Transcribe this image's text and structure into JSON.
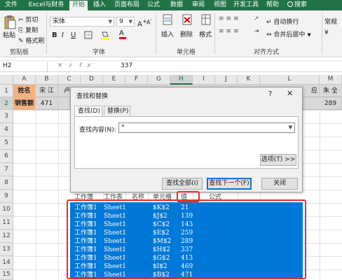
{
  "tabs": [
    {
      "label": "文件",
      "active": false
    },
    {
      "label": "Excel与财务",
      "active": false
    },
    {
      "label": "开始",
      "active": true
    },
    {
      "label": "插入",
      "active": false
    },
    {
      "label": "页面布局",
      "active": false
    },
    {
      "label": "公式",
      "active": false
    },
    {
      "label": "数据",
      "active": false
    },
    {
      "label": "审阅",
      "active": false
    },
    {
      "label": "视图",
      "active": false
    },
    {
      "label": "开发工具",
      "active": false
    },
    {
      "label": "帮助",
      "active": false
    }
  ],
  "search_label": "搜索",
  "colors": {
    "accent": "#217346",
    "selection": "#0078d7",
    "highlight": "#e03030",
    "header_cell": "#f4b183"
  },
  "ribbon": {
    "paste": "粘贴",
    "cut": "剪切",
    "copy": "复制",
    "format_painter": "格式刷",
    "clipboard_group": "剪贴板",
    "font_name": "宋体",
    "font_size": "9",
    "bold": "B",
    "italic": "I",
    "underline": "U",
    "font_group": "字体",
    "insert": "插入",
    "delete": "删除",
    "format": "格式",
    "cells_group": "单元格",
    "wrap_text": "自动换行",
    "merge_center": "合并后居中",
    "alignment_group": "对齐方式",
    "number_format": "常规",
    "currency": "¥"
  },
  "formula_bar": {
    "name_box": "H2",
    "value": "337"
  },
  "columns": [
    "A",
    "B",
    "C",
    "D",
    "E",
    "F",
    "G",
    "H",
    "I",
    "J",
    "K",
    "L",
    "M"
  ],
  "rows": [
    "1",
    "2",
    "3",
    "4",
    "5",
    "6",
    "7",
    "8",
    "9",
    "10",
    "11",
    "12",
    "13",
    "14",
    "15"
  ],
  "cells": {
    "a1": "姓名",
    "b1": "宋 江",
    "c1": "卢",
    "l1": "应",
    "m1": "朱 全",
    "a2": "销售额",
    "b2": "471",
    "m2": "289"
  },
  "dialog": {
    "title": "查找和替换",
    "help": "?",
    "close": "✕",
    "tab_find": "查找(D)",
    "tab_replace": "替换(P)",
    "find_label": "查找内容(N):",
    "find_value": "*",
    "options_button": "选项(T) >>",
    "find_all_button": "查找全部(I)",
    "find_next_button": "查找下一个(F)",
    "close_button": "关闭"
  },
  "results": {
    "headers": [
      "工作簿",
      "工作表",
      "名称",
      "单元格",
      "值",
      "公式"
    ],
    "rows": [
      {
        "workbook": "工作簿1",
        "sheet": "Sheet1",
        "cell": "$K$2",
        "value": "21"
      },
      {
        "workbook": "工作簿1",
        "sheet": "Sheet1",
        "cell": "$J$2",
        "value": "139"
      },
      {
        "workbook": "工作簿1",
        "sheet": "Sheet1",
        "cell": "$C$2",
        "value": "143"
      },
      {
        "workbook": "工作簿1",
        "sheet": "Sheet1",
        "cell": "$E$2",
        "value": "259"
      },
      {
        "workbook": "工作簿1",
        "sheet": "Sheet1",
        "cell": "$M$2",
        "value": "289"
      },
      {
        "workbook": "工作簿1",
        "sheet": "Sheet1",
        "cell": "$H$2",
        "value": "337"
      },
      {
        "workbook": "工作簿1",
        "sheet": "Sheet1",
        "cell": "$G$2",
        "value": "413"
      },
      {
        "workbook": "工作簿1",
        "sheet": "Sheet1",
        "cell": "$I$2",
        "value": "469"
      },
      {
        "workbook": "工作簿1",
        "sheet": "Sheet1",
        "cell": "$B$2",
        "value": "471"
      }
    ]
  }
}
